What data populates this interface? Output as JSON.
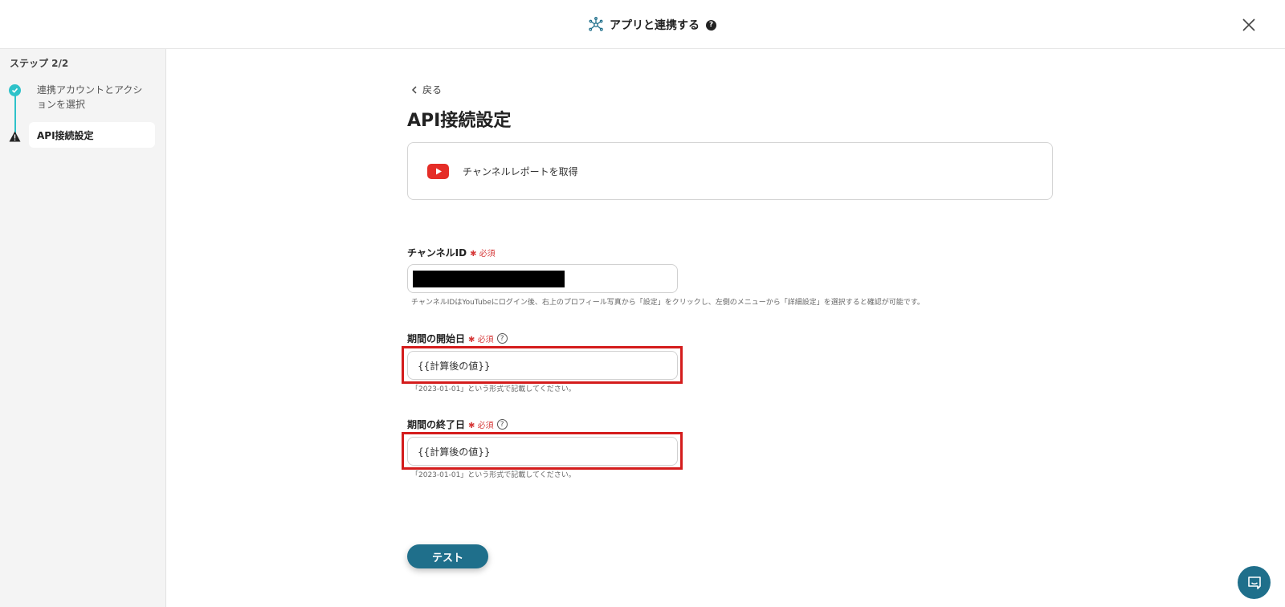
{
  "header": {
    "title": "アプリと連携する",
    "help_glyph": "?",
    "icon": "integration-hub-icon",
    "close_icon": "close-icon"
  },
  "sidebar": {
    "step_label": "ステップ 2/2",
    "steps": [
      {
        "label": "連携アカウントとアクションを選択",
        "status": "completed",
        "icon": "check-icon"
      },
      {
        "label": "API接続設定",
        "status": "warning",
        "icon": "warning-icon"
      }
    ]
  },
  "main": {
    "back_label": "戻る",
    "page_title": "API接続設定",
    "action": {
      "label": "チャンネルレポートを取得",
      "icon": "youtube-icon"
    },
    "fields": [
      {
        "label": "チャンネルID",
        "required": "✱ 必須",
        "value": "",
        "redacted": true,
        "hint": "チャンネルIDはYouTubeにログイン後、右上のプロフィール写真から「設定」をクリックし、左側のメニューから「詳細設定」を選択すると確認が可能です。"
      },
      {
        "label": "期間の開始日",
        "required": "✱ 必須",
        "help_glyph": "?",
        "value": "{{計算後の値}}",
        "hint": "「2023-01-01」という形式で記載してください。"
      },
      {
        "label": "期間の終了日",
        "required": "✱ 必須",
        "help_glyph": "?",
        "value": "{{計算後の値}}",
        "hint": "「2023-01-01」という形式で記載してください。"
      }
    ],
    "test_button": "テスト"
  },
  "chat_icon": "chat-icon",
  "colors": {
    "accent": "#2ec2c9",
    "primary_button": "#1f6f8b",
    "required": "#d63a3a",
    "highlight_border": "#d41c1c",
    "youtube_red": "#e52d27"
  }
}
